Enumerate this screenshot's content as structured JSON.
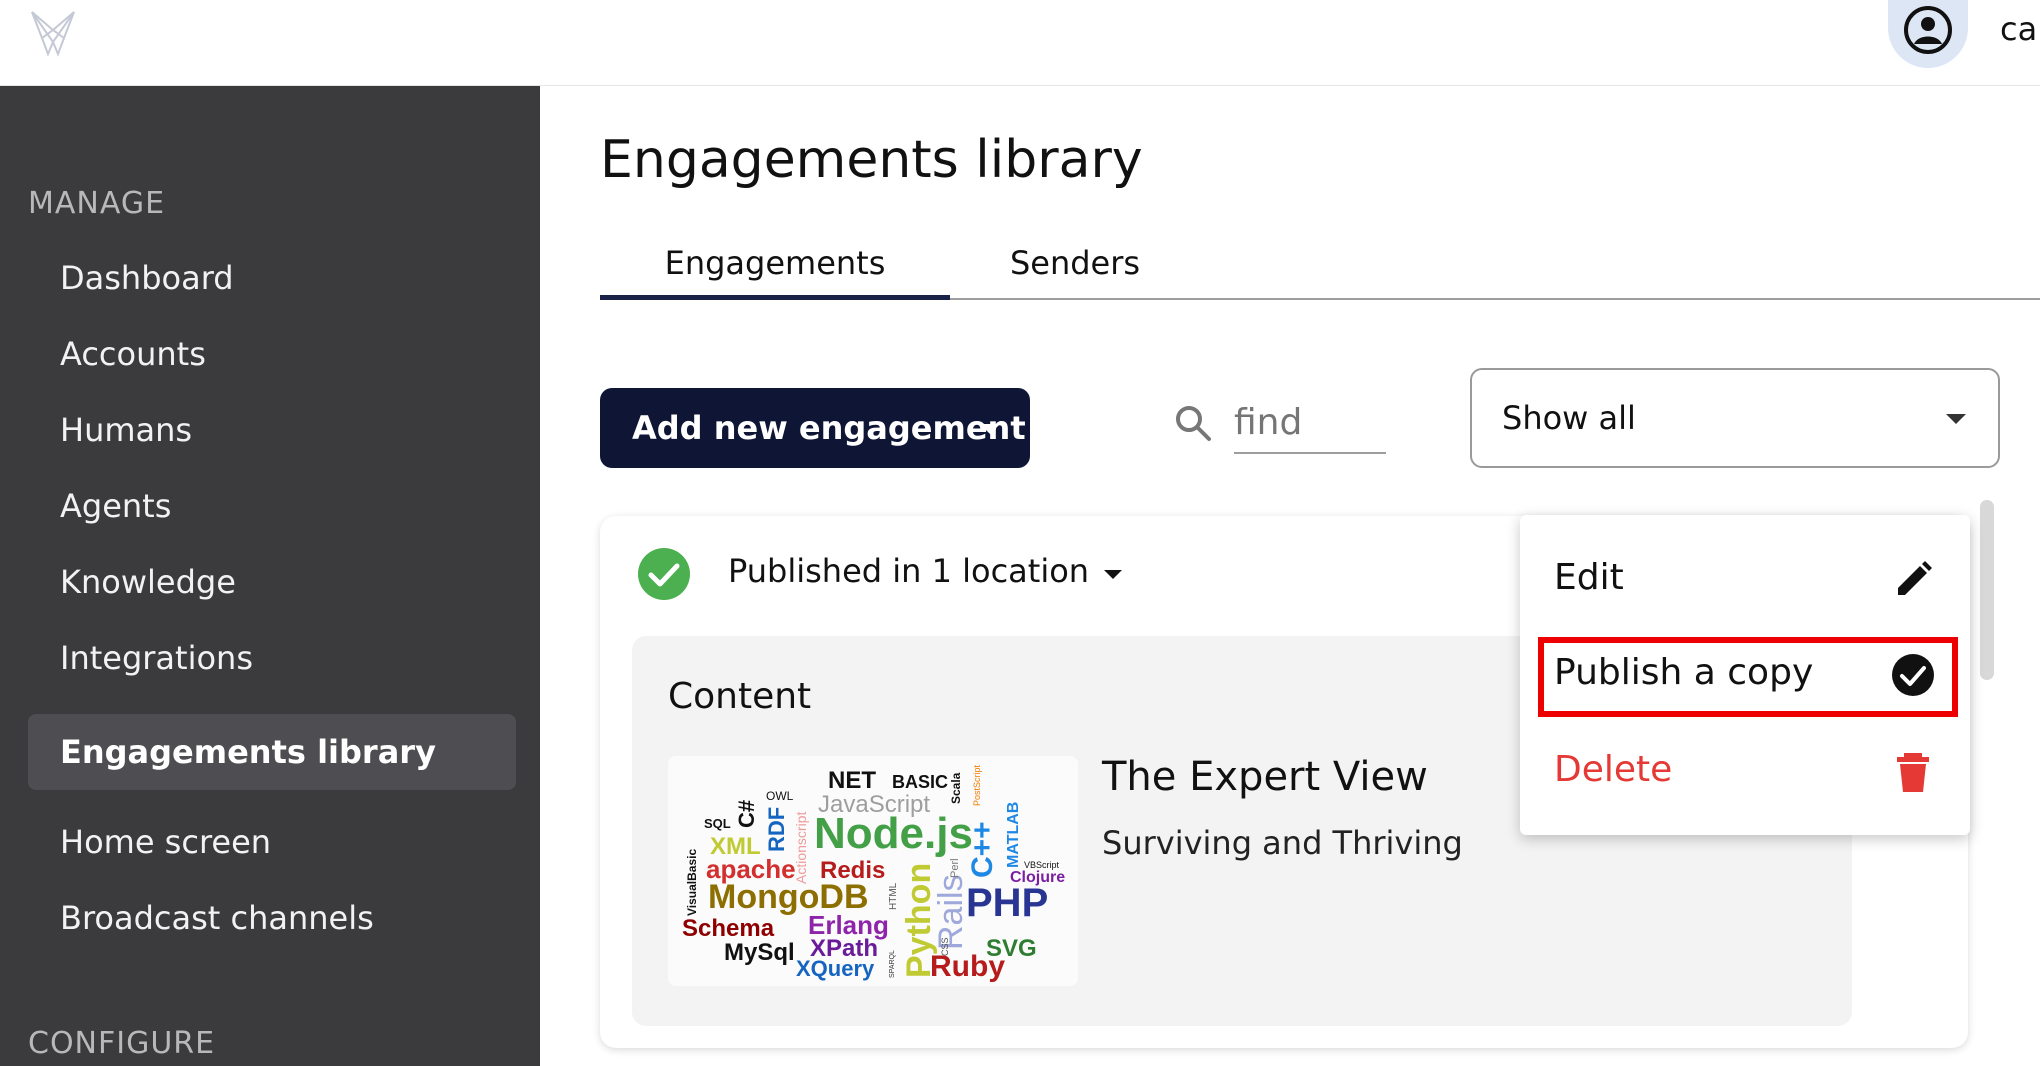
{
  "header": {
    "logo_icon": "butterfly-logo-icon",
    "avatar_icon": "account-circle-icon",
    "user_label": "ca"
  },
  "sidebar": {
    "section_manage": "MANAGE",
    "items": [
      {
        "label": "Dashboard"
      },
      {
        "label": "Accounts"
      },
      {
        "label": "Humans"
      },
      {
        "label": "Agents"
      },
      {
        "label": "Knowledge"
      },
      {
        "label": "Integrations"
      },
      {
        "label": "Engagements library",
        "active": true
      },
      {
        "label": "Home screen"
      },
      {
        "label": "Broadcast channels"
      }
    ],
    "section_configure": "CONFIGURE"
  },
  "main": {
    "title": "Engagements library",
    "tabs": [
      {
        "label": "Engagements",
        "active": true
      },
      {
        "label": "Senders"
      }
    ],
    "add_button_label": "Add new engagement",
    "search_placeholder": "find",
    "filter_value": "Show all",
    "card": {
      "status_text": "Published in 1 location",
      "status_color": "#4caf50",
      "content_label": "Content",
      "title": "The Expert View",
      "subtitle": "Surviving and Thriving",
      "thumbnail_words": [
        {
          "text": "NET",
          "color": "#111111"
        },
        {
          "text": "BASIC",
          "color": "#111111"
        },
        {
          "text": "OWL",
          "color": "#111111"
        },
        {
          "text": "JavaScript",
          "color": "#9e9e9e"
        },
        {
          "text": "Scala",
          "color": "#111111"
        },
        {
          "text": "PostScript",
          "color": "#f57c00"
        },
        {
          "text": "SQL",
          "color": "#111111"
        },
        {
          "text": "C#",
          "color": "#111111"
        },
        {
          "text": "RDF",
          "color": "#1565c0"
        },
        {
          "text": "Actionscript",
          "color": "#ef9a9a"
        },
        {
          "text": "Node.js",
          "color": "#43a047"
        },
        {
          "text": "C++",
          "color": "#1e88e5"
        },
        {
          "text": "MATLAB",
          "color": "#1e88e5"
        },
        {
          "text": "XML",
          "color": "#c0ca33"
        },
        {
          "text": "VisualBasic",
          "color": "#111111"
        },
        {
          "text": "apache",
          "color": "#d32f2f"
        },
        {
          "text": "Redis",
          "color": "#b71c1c"
        },
        {
          "text": "Python",
          "color": "#c0ca33"
        },
        {
          "text": "Rails",
          "color": "#9fa8da"
        },
        {
          "text": "Perl",
          "color": "#777777"
        },
        {
          "text": "VBScript",
          "color": "#111111"
        },
        {
          "text": "Clojure",
          "color": "#7b1fa2"
        },
        {
          "text": "MongoDB",
          "color": "#8d6e00"
        },
        {
          "text": "HTML",
          "color": "#555555"
        },
        {
          "text": "PHP",
          "color": "#283593"
        },
        {
          "text": "Schema",
          "color": "#8e0000"
        },
        {
          "text": "Erlang",
          "color": "#8e24aa"
        },
        {
          "text": "CSS",
          "color": "#555555"
        },
        {
          "text": "SVG",
          "color": "#2e7d32"
        },
        {
          "text": "MySql",
          "color": "#111111"
        },
        {
          "text": "XPath",
          "color": "#6a1b9a"
        },
        {
          "text": "XQuery",
          "color": "#1565c0"
        },
        {
          "text": "SPARQL",
          "color": "#333333"
        },
        {
          "text": "Ruby",
          "color": "#b71c1c"
        }
      ]
    },
    "menu": {
      "items": [
        {
          "label": "Edit",
          "icon": "pencil-icon"
        },
        {
          "label": "Publish a copy",
          "icon": "check-circle-icon",
          "highlighted": true
        },
        {
          "label": "Delete",
          "icon": "trash-icon",
          "color": "#e53935"
        }
      ]
    }
  }
}
